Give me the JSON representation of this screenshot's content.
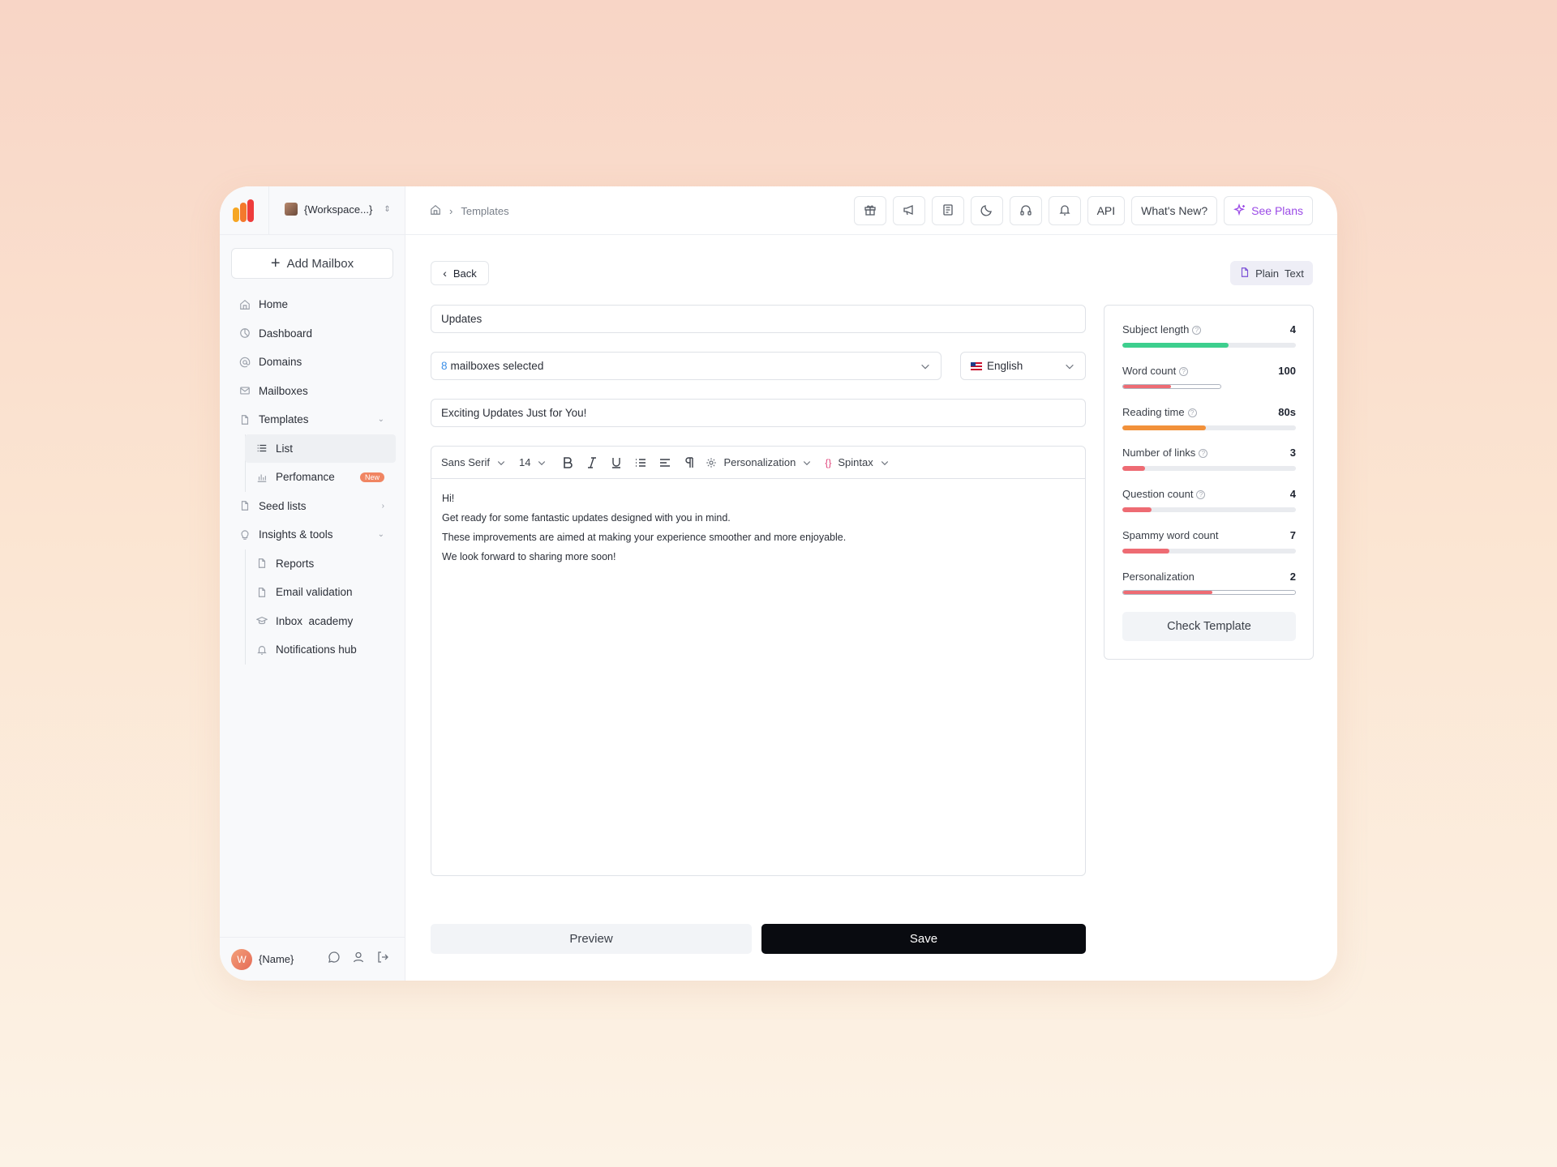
{
  "workspace": {
    "name": "{Workspace...}"
  },
  "sidebar": {
    "add_mailbox": "Add Mailbox",
    "items": [
      {
        "label": "Home",
        "icon": "home-icon"
      },
      {
        "label": "Dashboard",
        "icon": "dashboard-icon"
      },
      {
        "label": "Domains",
        "icon": "at-icon"
      },
      {
        "label": "Mailboxes",
        "icon": "mail-icon"
      },
      {
        "label": "Templates",
        "icon": "file-icon"
      },
      {
        "label": "List",
        "icon": "list-icon"
      },
      {
        "label": "Perfomance",
        "icon": "chart-icon",
        "badge": "New"
      },
      {
        "label": "Seed lists",
        "icon": "file-icon"
      },
      {
        "label": "Insights & tools",
        "icon": "bulb-icon"
      },
      {
        "label": "Reports",
        "icon": "file-icon"
      },
      {
        "label": "Email validation",
        "icon": "file-icon"
      },
      {
        "label": "Inbox  academy",
        "icon": "academy-icon"
      },
      {
        "label": "Notifications hub",
        "icon": "bell-icon"
      }
    ],
    "user": {
      "initial": "W",
      "name": "{Name}"
    }
  },
  "topbar": {
    "breadcrumb": "Templates",
    "api": "API",
    "whats_new": "What's New?",
    "see_plans": "See Plans"
  },
  "editor": {
    "back": "Back",
    "plain_text": "Plain  Text",
    "template_name": "Updates",
    "mailboxes_count": "8",
    "mailboxes_text": "mailboxes selected",
    "language": "English",
    "subject": "Exciting Updates Just for You!",
    "font": "Sans Serif",
    "font_size": "14",
    "personalization": "Personalization",
    "spintax": "Spintax",
    "body": [
      "Hi!",
      "Get ready for some fantastic updates designed with you in mind.",
      "These improvements are aimed at making your experience smoother and more enjoyable.",
      "We look forward to sharing more soon!"
    ],
    "preview": "Preview",
    "save": "Save"
  },
  "metrics": {
    "items": [
      {
        "label": "Subject length",
        "value": "4",
        "help": true,
        "fraction": 0.61,
        "color": "#3dcf8e"
      },
      {
        "label": "Word count",
        "value": "100",
        "help": true,
        "fraction": 0.28,
        "color": "#ee6b73",
        "outlined": true,
        "track": 0.57
      },
      {
        "label": "Reading time",
        "value": "80s",
        "help": true,
        "fraction": 0.48,
        "color": "#f2913a"
      },
      {
        "label": "Number of links",
        "value": "3",
        "help": true,
        "fraction": 0.13,
        "color": "#ee6b73"
      },
      {
        "label": "Question count",
        "value": "4",
        "help": true,
        "fraction": 0.17,
        "color": "#ee6b73"
      },
      {
        "label": "Spammy word count",
        "value": "7",
        "help": false,
        "fraction": 0.27,
        "color": "#ee6b73"
      },
      {
        "label": "Personalization",
        "value": "2",
        "help": false,
        "fraction": 0.52,
        "color": "#ee6b73",
        "outlined": true
      }
    ],
    "check_button": "Check Template"
  }
}
